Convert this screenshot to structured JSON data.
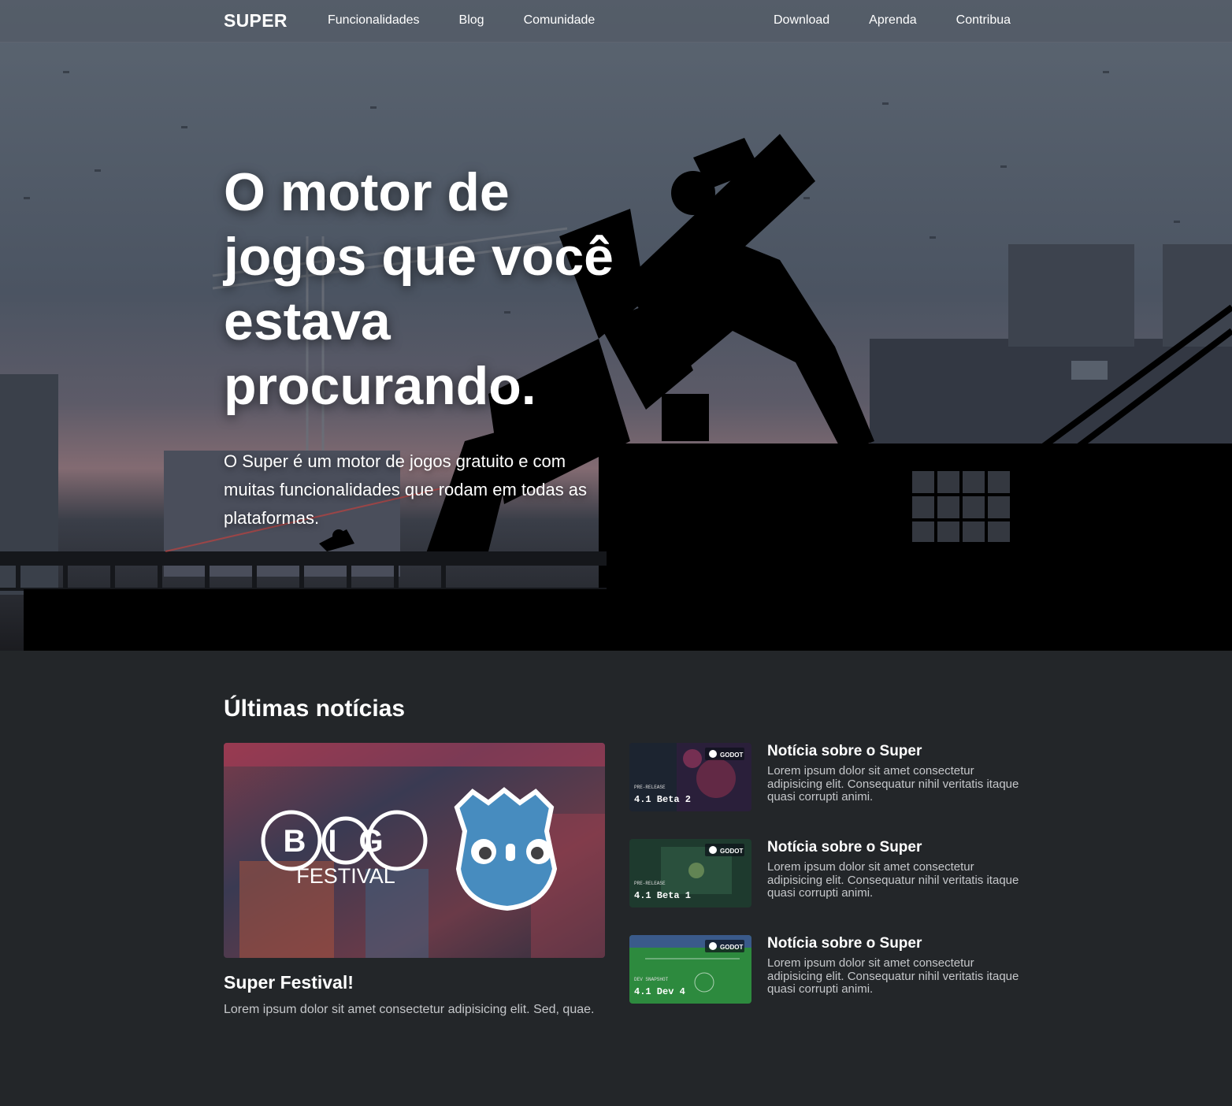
{
  "nav": {
    "brand": "SUPER",
    "left_links": [
      "Funcionalidades",
      "Blog",
      "Comunidade"
    ],
    "right_links": [
      "Download",
      "Aprenda",
      "Contribua"
    ]
  },
  "hero": {
    "title": "O motor de jogos que você estava procurando.",
    "subtitle": "O Super é um motor de jogos gratuito e com muitas funcionalidades que rodam em todas as plataformas."
  },
  "news": {
    "heading": "Últimas notícias",
    "featured": {
      "image_text": "BIG",
      "image_subtext": "FESTIVAL",
      "title": "Super Festival!",
      "text": "Lorem ipsum dolor sit amet consectetur adipisicing elit. Sed, quae."
    },
    "items": [
      {
        "thumb_badge": "GODOT",
        "thumb_kicker": "PRE-RELEASE",
        "thumb_label": "4.1 Beta 2",
        "title": "Notícia sobre o Super",
        "text": "Lorem ipsum dolor sit amet consectetur adipisicing elit. Consequatur nihil veritatis itaque quasi corrupti animi."
      },
      {
        "thumb_badge": "GODOT",
        "thumb_kicker": "PRE-RELEASE",
        "thumb_label": "4.1 Beta 1",
        "title": "Notícia sobre o Super",
        "text": "Lorem ipsum dolor sit amet consectetur adipisicing elit. Consequatur nihil veritatis itaque quasi corrupti animi."
      },
      {
        "thumb_badge": "GODOT",
        "thumb_kicker": "DEV SNAPSHOT",
        "thumb_label": "4.1 Dev 4",
        "title": "Notícia sobre o Super",
        "text": "Lorem ipsum dolor sit amet consectetur adipisicing elit. Consequatur nihil veritatis itaque quasi corrupti animi."
      }
    ]
  },
  "colors": {
    "page_background": "#232629",
    "text": "#ffffff",
    "muted_text": "#c5c7ca",
    "logo_blue": "#478cbf"
  }
}
